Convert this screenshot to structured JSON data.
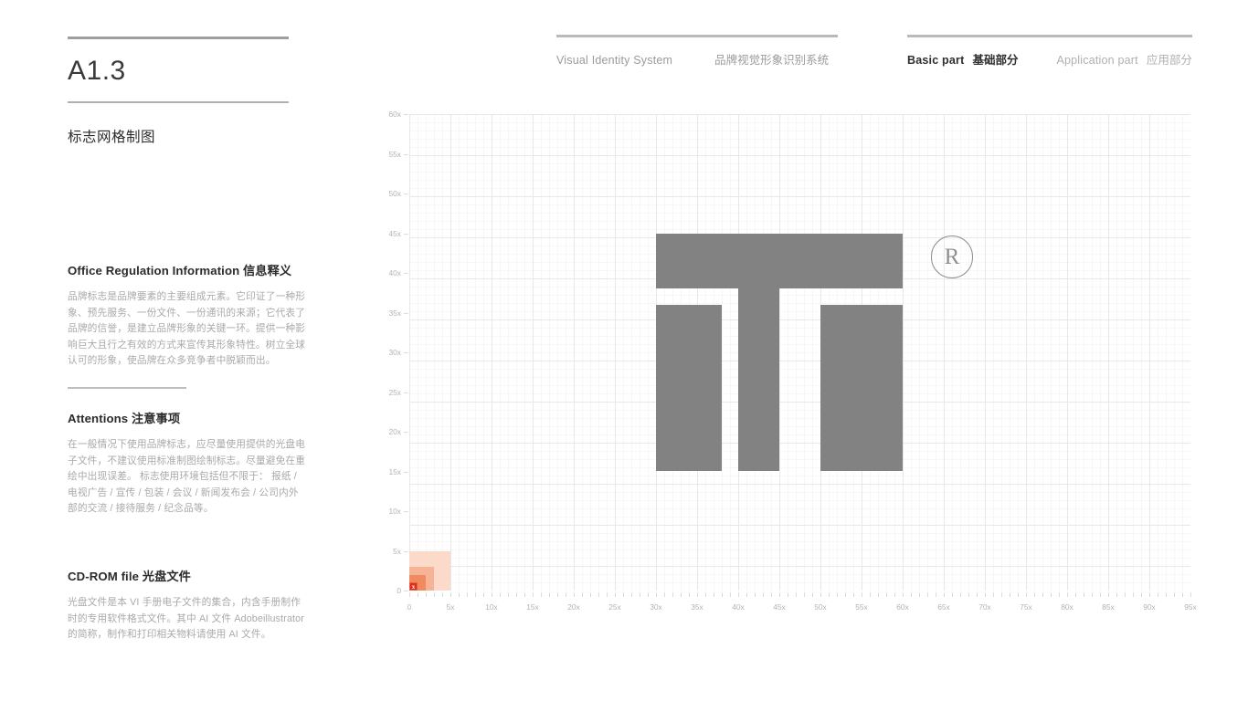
{
  "header": {
    "left_group": {
      "title_en": "Visual Identity System",
      "title_cn": "品牌视觉形象识别系统"
    },
    "nav": [
      {
        "label_en": "Basic part",
        "label_cn": "基础部分",
        "active": true
      },
      {
        "label_en": "Application part",
        "label_cn": "应用部分",
        "active": false
      }
    ]
  },
  "sidebar": {
    "section_code": "A1.3",
    "section_title": "标志网格制图",
    "blocks": [
      {
        "heading": "Office Regulation Information 信息释义",
        "body": "品牌标志是品牌要素的主要组成元素。它印证了一种形象、预先服务、一份文件、一份通讯的来源；它代表了品牌的信誉，是建立品牌形象的关键一环。提供一种影响巨大且行之有效的方式来宣传其形象特性。树立全球认可的形象，使品牌在众多竞争者中脱颖而出。"
      },
      {
        "heading": "Attentions 注意事项",
        "body": "在一般情况下使用品牌标志，应尽量使用提供的光盘电子文件，不建议使用标准制图绘制标志。尽量避免在重绘中出现误差。\n标志使用环境包括但不限于：\n报纸 / 电视广告 / 宣传 / 包装 / 会议 / 新闻发布会 / 公司内外部的交流 / 接待服务 / 纪念品等。"
      },
      {
        "heading": "CD-ROM file 光盘文件",
        "body": "光盘文件是本 VI 手册电子文件的集合，内含手册制作时的专用软件格式文件。其中 AI 文件 Adobeillustrator 的简称，制作和打印相关物料请使用 AI 文件。"
      }
    ]
  },
  "chart_data": {
    "type": "diagram",
    "title": "标志网格制图",
    "xlabel": "",
    "ylabel": "",
    "xlim": [
      0,
      95
    ],
    "ylim": [
      0,
      60
    ],
    "unit": "x",
    "x_ticks": [
      "0",
      "5x",
      "10x",
      "15x",
      "20x",
      "25x",
      "30x",
      "35x",
      "40x",
      "45x",
      "50x",
      "55x",
      "60x",
      "65x",
      "70x",
      "75x",
      "80x",
      "85x",
      "90x",
      "95x"
    ],
    "x_tick_values": [
      0,
      5,
      10,
      15,
      20,
      25,
      30,
      35,
      40,
      45,
      50,
      55,
      60,
      65,
      70,
      75,
      80,
      85,
      90,
      95
    ],
    "y_ticks": [
      "0",
      "5x",
      "10x",
      "15x",
      "20x",
      "25x",
      "30x",
      "35x",
      "40x",
      "45x",
      "50x",
      "55x",
      "60x"
    ],
    "y_tick_values": [
      0,
      5,
      10,
      15,
      20,
      25,
      30,
      35,
      40,
      45,
      50,
      55,
      60
    ],
    "grid": {
      "minor_step": 1,
      "major_step": 5,
      "minor_color": "#f7f7f7",
      "major_color": "#e8e8e8"
    },
    "logo_color": "#828282",
    "logo_shapes": [
      {
        "name": "top-crossbar",
        "x0": 30,
        "y0": 38,
        "x1": 60,
        "y1": 45
      },
      {
        "name": "left-stem",
        "x0": 30,
        "y0": 15,
        "x1": 38,
        "y1": 36
      },
      {
        "name": "center-stem",
        "x0": 40,
        "y0": 15,
        "x1": 45,
        "y1": 38
      },
      {
        "name": "right-stem",
        "x0": 50,
        "y0": 15,
        "x1": 60,
        "y1": 36
      }
    ],
    "registered_mark": {
      "symbol": "R",
      "cx": 66,
      "cy": 42,
      "radius": 2.6
    },
    "unit_swatches": [
      {
        "name": "swatch-5x",
        "x0": 0,
        "y0": 0,
        "x1": 5,
        "y1": 5,
        "color": "#fbdac9"
      },
      {
        "name": "swatch-3x",
        "x0": 0,
        "y0": 0,
        "x1": 3,
        "y1": 3,
        "color": "#f6b395"
      },
      {
        "name": "swatch-2x",
        "x0": 0,
        "y0": 0,
        "x1": 2,
        "y1": 2,
        "color": "#f08a60"
      },
      {
        "name": "swatch-1x",
        "x0": 0,
        "y0": 0,
        "x1": 1,
        "y1": 1,
        "color": "#e8613a"
      }
    ],
    "unit_marker": {
      "label": "x",
      "color": "#e02b20",
      "x": 0,
      "y": 0,
      "size": 1
    }
  }
}
